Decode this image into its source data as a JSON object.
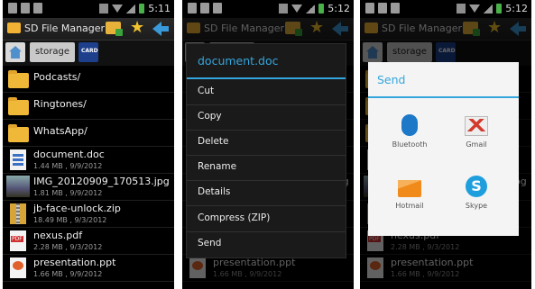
{
  "status": {
    "time1": "5:11",
    "time2": "5:12",
    "time3": "5:12"
  },
  "app": {
    "title": "SD File Manager"
  },
  "path": {
    "storage_label": "storage",
    "sdcard_label": "CARD"
  },
  "files": [
    {
      "name": "Podcasts/",
      "type": "folder"
    },
    {
      "name": "Ringtones/",
      "type": "folder"
    },
    {
      "name": "WhatsApp/",
      "type": "folder"
    },
    {
      "name": "document.doc",
      "meta": "1.44 MB , 9/9/2012",
      "type": "doc"
    },
    {
      "name": "IMG_20120909_170513.jpg",
      "meta": "1.81 MB , 9/9/2012",
      "type": "img"
    },
    {
      "name": "jb-face-unlock.zip",
      "meta": "18.49 MB , 9/3/2012",
      "type": "zip"
    },
    {
      "name": "nexus.pdf",
      "meta": "2.28 MB , 9/3/2012",
      "type": "pdf"
    },
    {
      "name": "presentation.ppt",
      "meta": "1.66 MB , 9/9/2012",
      "type": "ppt"
    }
  ],
  "context_menu": {
    "title": "document.doc",
    "items": [
      "Cut",
      "Copy",
      "Delete",
      "Rename",
      "Details",
      "Compress (ZIP)",
      "Send"
    ]
  },
  "send_dialog": {
    "title": "Send",
    "apps": [
      "Bluetooth",
      "Gmail",
      "Hotmail",
      "Skype"
    ]
  },
  "colors": {
    "accent": "#35a6dd",
    "folder": "#f0b838",
    "star": "#f2c12e",
    "background": "#000000"
  },
  "icons": {
    "new_folder": "new-folder-icon",
    "bookmark": "star-icon",
    "back": "back-arrow-icon",
    "home": "home-icon",
    "sdcard": "sd-card-icon"
  }
}
